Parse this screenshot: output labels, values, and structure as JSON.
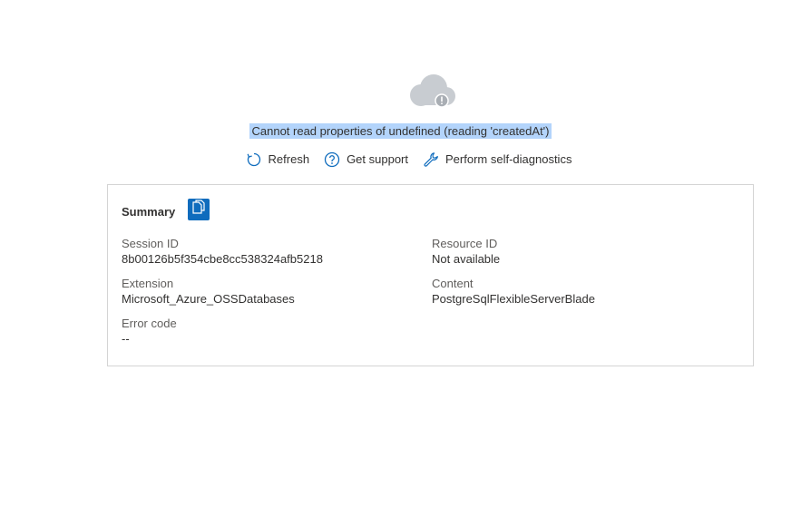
{
  "error": {
    "icon": "cloud-warning-icon",
    "message": "Cannot read properties of undefined (reading 'createdAt')"
  },
  "actions": [
    {
      "label": "Refresh",
      "icon": "refresh-icon"
    },
    {
      "label": "Get support",
      "icon": "help-circle-icon"
    },
    {
      "label": "Perform self-diagnostics",
      "icon": "wrench-icon"
    }
  ],
  "summary": {
    "title": "Summary",
    "copy_icon": "copy-icon",
    "session_id": {
      "label": "Session ID",
      "value": "8b00126b5f354cbe8cc538324afb5218"
    },
    "resource_id": {
      "label": "Resource ID",
      "value": "Not available"
    },
    "extension": {
      "label": "Extension",
      "value": "Microsoft_Azure_OSSDatabases"
    },
    "content": {
      "label": "Content",
      "value": "PostgreSqlFlexibleServerBlade"
    },
    "error_code": {
      "label": "Error code",
      "value": "--"
    }
  },
  "colors": {
    "accent": "#0f6cbd",
    "selection": "#b3d4fb",
    "cloud": "#c8ccd1",
    "border": "#d4d4d4"
  }
}
